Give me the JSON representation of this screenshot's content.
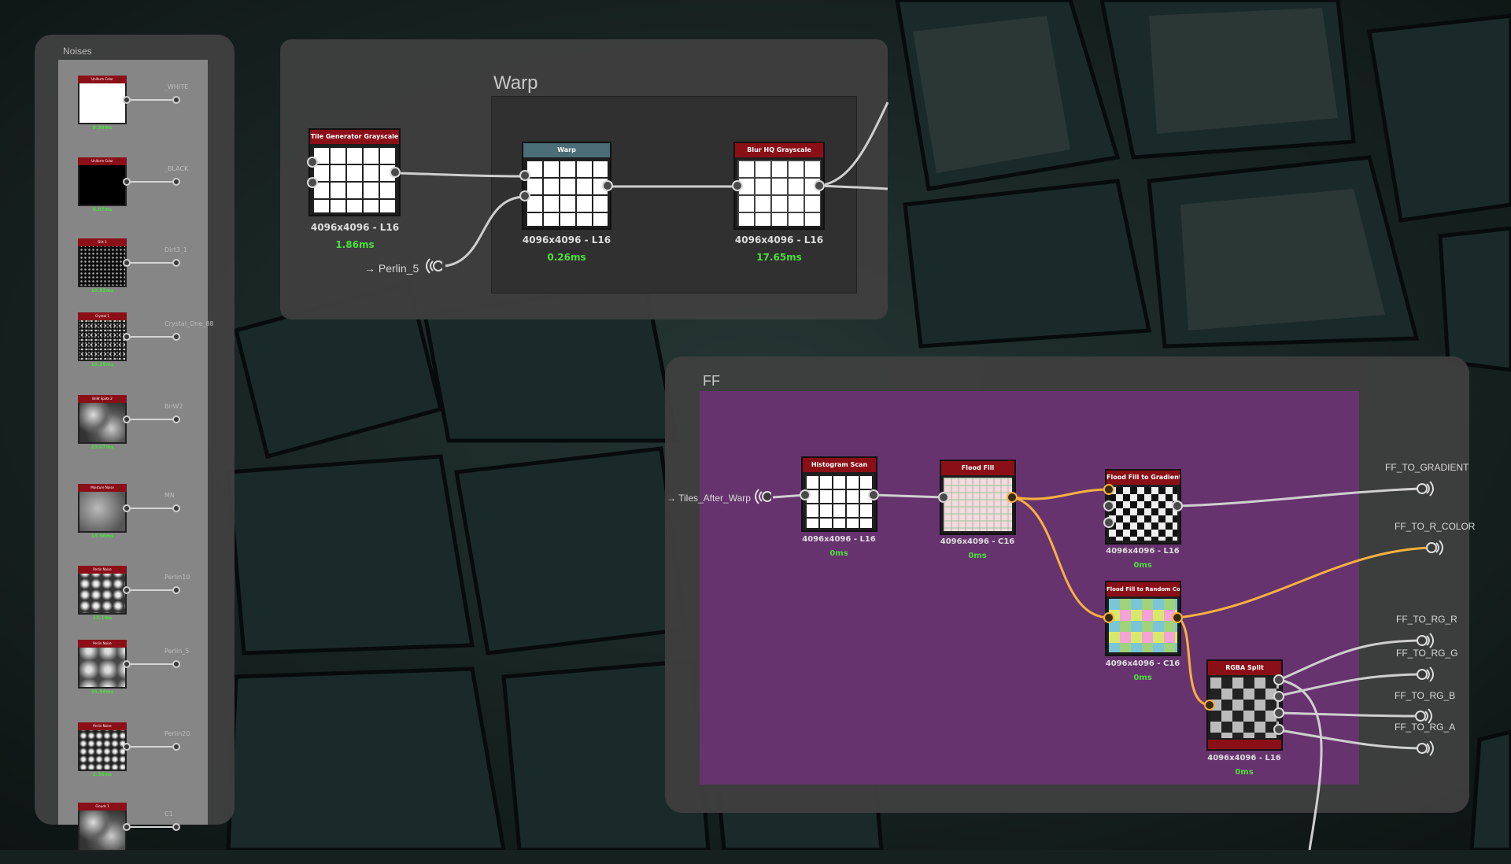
{
  "colors": {
    "node_header_red": "#8b0f17",
    "node_header_teal": "#4a6d78",
    "timing_green": "#4cde3c",
    "wire_orange": "#f6b13f",
    "ff_frame_purple": "#67336f"
  },
  "noises_panel": {
    "title": "Noises",
    "items": [
      {
        "header": "Uniform Color",
        "timing": "0.38ms",
        "output": "_WHITE",
        "thumb": "white"
      },
      {
        "header": "Uniform Color",
        "timing": "0.07ms",
        "output": "_BLACK",
        "thumb": "black"
      },
      {
        "header": "Dirt 3",
        "timing": "10.82ms",
        "output": "Dirt3_1",
        "thumb": "speckle"
      },
      {
        "header": "Crystal 1",
        "timing": "10.29ms",
        "output": "Crystal_One_88",
        "thumb": "speckle2"
      },
      {
        "header": "BnW Spots 2",
        "timing": "29.07ms",
        "output": "BnW2",
        "thumb": "cloud"
      },
      {
        "header": "Moisture Noise",
        "timing": "18.96ms",
        "output": "MN",
        "thumb": "cloudsoft"
      },
      {
        "header": "Perlin Noise",
        "timing": "13.1ms",
        "output": "Perlin10",
        "thumb": "blobs"
      },
      {
        "header": "Perlin Noise",
        "timing": "35.54ms",
        "output": "Perlin_5",
        "thumb": "blobsoft"
      },
      {
        "header": "Perlin Noise",
        "timing": "3.38ms",
        "output": "Perlin20",
        "thumb": "blobsmall"
      },
      {
        "header": "Clouds 1",
        "timing": "",
        "output": "C1",
        "thumb": "cloud"
      }
    ]
  },
  "warp_frame": {
    "title": "Warp",
    "input_label": "→ Perlin_5",
    "nodes": [
      {
        "title": "Tile Generator Grayscale",
        "res": "4096x4096 - L16",
        "timing": "1.86ms"
      },
      {
        "title": "Warp",
        "res": "4096x4096 - L16",
        "timing": "0.26ms"
      },
      {
        "title": "Blur HQ Grayscale",
        "res": "4096x4096 - L16",
        "timing": "17.65ms"
      }
    ]
  },
  "ff_frame": {
    "title": "FF",
    "input_label": "→ Tiles_After_Warp",
    "nodes": [
      {
        "title": "Histogram Scan",
        "res": "4096x4096 - L16",
        "timing": "0ms"
      },
      {
        "title": "Flood Fill",
        "res": "4096x4096 - C16",
        "timing": "0ms"
      },
      {
        "title": "Flood Fill to Gradient",
        "res": "4096x4096 - L16",
        "timing": "0ms"
      },
      {
        "title": "Flood Fill to Random Color",
        "res": "4096x4096 - C16",
        "timing": "0ms"
      },
      {
        "title": "RGBA Split",
        "res": "4096x4096 - L16",
        "timing": "0ms"
      }
    ],
    "outputs": [
      "FF_TO_GRADIENT",
      "FF_TO_R_COLOR",
      "FF_TO_RG_R",
      "FF_TO_RG_G",
      "FF_TO_RG_B",
      "FF_TO_RG_A"
    ]
  }
}
